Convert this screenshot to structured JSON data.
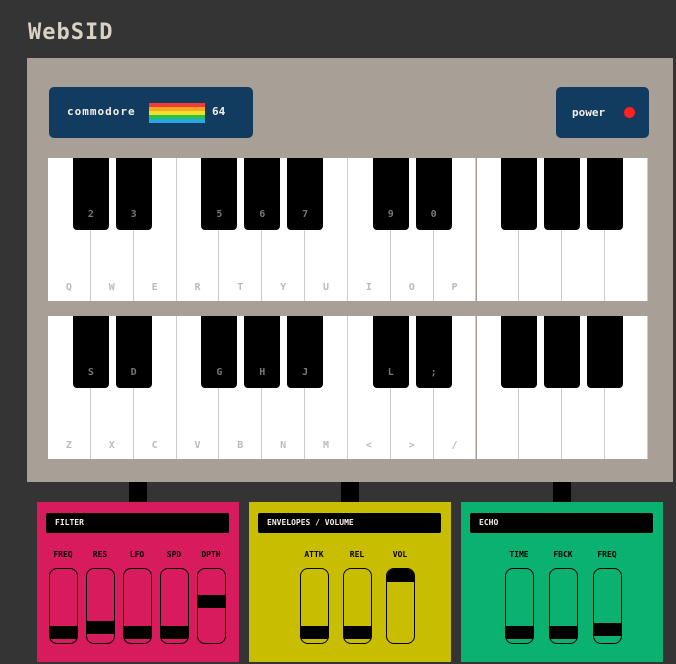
{
  "app": {
    "title": "WebSID"
  },
  "brand": {
    "text": "commodore",
    "number": "64",
    "stripes": [
      "#f23b3b",
      "#f5a623",
      "#f2df2b",
      "#2bc24a",
      "#2aa6e8"
    ]
  },
  "power": {
    "label": "power",
    "led_color": "#ff2020"
  },
  "keyboard": {
    "row1": {
      "white": [
        "Q",
        "W",
        "E",
        "R",
        "T",
        "Y",
        "U",
        "I",
        "O",
        "P",
        "",
        "",
        "",
        ""
      ],
      "black": [
        {
          "label": "2",
          "after": 0
        },
        {
          "label": "3",
          "after": 1
        },
        {
          "label": "5",
          "after": 3
        },
        {
          "label": "6",
          "after": 4
        },
        {
          "label": "7",
          "after": 5
        },
        {
          "label": "9",
          "after": 7
        },
        {
          "label": "0",
          "after": 8
        },
        {
          "label": "",
          "after": 10
        },
        {
          "label": "",
          "after": 11
        },
        {
          "label": "",
          "after": 12
        }
      ]
    },
    "row2": {
      "white": [
        "Z",
        "X",
        "C",
        "V",
        "B",
        "N",
        "M",
        "<",
        ">",
        "/",
        "",
        "",
        "",
        ""
      ],
      "black": [
        {
          "label": "S",
          "after": 0
        },
        {
          "label": "D",
          "after": 1
        },
        {
          "label": "G",
          "after": 3
        },
        {
          "label": "H",
          "after": 4
        },
        {
          "label": "J",
          "after": 5
        },
        {
          "label": "L",
          "after": 7
        },
        {
          "label": ";",
          "after": 8
        },
        {
          "label": "",
          "after": 10
        },
        {
          "label": "",
          "after": 11
        },
        {
          "label": "",
          "after": 12
        }
      ]
    }
  },
  "filter": {
    "title": "FILTER",
    "color": "#d81b5c",
    "sliders": [
      {
        "label": "FREQ",
        "value": 0.0
      },
      {
        "label": "RES",
        "value": 0.08
      },
      {
        "label": "LFO",
        "value": 0.0
      },
      {
        "label": "SPD",
        "value": 0.0
      },
      {
        "label": "DPTH",
        "value": 0.55
      }
    ]
  },
  "envelopes": {
    "title": "ENVELOPES / VOLUME",
    "color": "#c9bd00",
    "sliders": [
      {
        "label": "ATTK",
        "value": 0.0
      },
      {
        "label": "REL",
        "value": 0.0
      },
      {
        "label": "VOL",
        "value": 1.0
      }
    ]
  },
  "echo": {
    "title": "ECHO",
    "color": "#0bb26f",
    "sliders": [
      {
        "label": "TIME",
        "value": 0.0
      },
      {
        "label": "FBCK",
        "value": 0.0
      },
      {
        "label": "FREQ",
        "value": 0.05
      }
    ]
  }
}
